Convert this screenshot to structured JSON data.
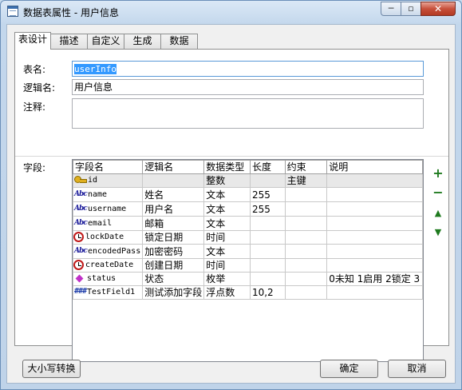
{
  "window": {
    "title": "数据表属性 - 用户信息",
    "minimize_glyph": "─",
    "maximize_glyph": "▫",
    "close_glyph": "✕"
  },
  "tabs": [
    "表设计",
    "描述",
    "自定义",
    "生成",
    "数据"
  ],
  "form": {
    "table_name_label": "表名:",
    "table_name_value": "userInfo",
    "logical_name_label": "逻辑名:",
    "logical_name_value": "用户信息",
    "comment_label": "注释:",
    "comment_value": "",
    "fields_label": "字段:"
  },
  "grid": {
    "columns": [
      "字段名",
      "逻辑名",
      "数据类型",
      "长度",
      "约束",
      "说明"
    ],
    "rows": [
      {
        "icon": "key-icon",
        "name": "id",
        "logical": "",
        "type": "整数",
        "length": "",
        "constraint": "主键",
        "desc": ""
      },
      {
        "icon": "text-type-icon",
        "name": "name",
        "logical": "姓名",
        "type": "文本",
        "length": "255",
        "constraint": "",
        "desc": ""
      },
      {
        "icon": "text-type-icon",
        "name": "username",
        "logical": "用户名",
        "type": "文本",
        "length": "255",
        "constraint": "",
        "desc": ""
      },
      {
        "icon": "text-type-icon",
        "name": "email",
        "logical": "邮箱",
        "type": "文本",
        "length": "",
        "constraint": "",
        "desc": ""
      },
      {
        "icon": "clock-icon",
        "name": "lockDate",
        "logical": "锁定日期",
        "type": "时间",
        "length": "",
        "constraint": "",
        "desc": ""
      },
      {
        "icon": "text-type-icon",
        "name": "encodedPass",
        "logical": "加密密码",
        "type": "文本",
        "length": "",
        "constraint": "",
        "desc": ""
      },
      {
        "icon": "clock-icon",
        "name": "createDate",
        "logical": "创建日期",
        "type": "时间",
        "length": "",
        "constraint": "",
        "desc": ""
      },
      {
        "icon": "enum-icon",
        "name": "status",
        "logical": "状态",
        "type": "枚举",
        "length": "",
        "constraint": "",
        "desc": "0未知 1启用 2锁定 3"
      },
      {
        "icon": "number-type-icon",
        "name": "TestField1",
        "logical": "测试添加字段",
        "type": "浮点数",
        "length": "10,2",
        "constraint": "",
        "desc": ""
      }
    ]
  },
  "side_buttons": {
    "add": "+",
    "remove": "−",
    "up": "▲",
    "down": "▼"
  },
  "buttons": {
    "case_convert": "大小写转换",
    "ok": "确定",
    "cancel": "取消"
  }
}
